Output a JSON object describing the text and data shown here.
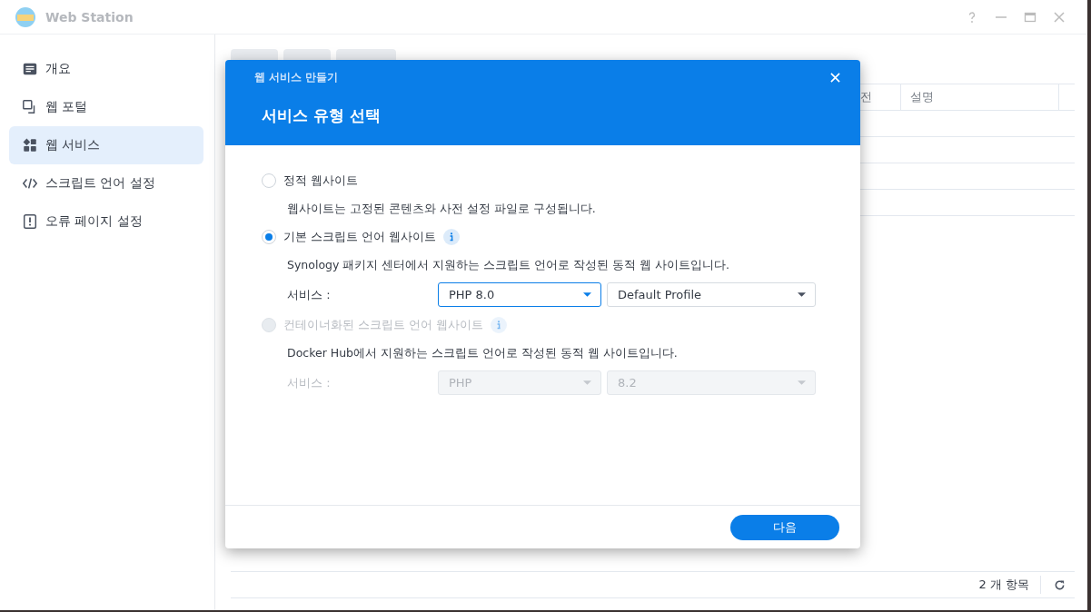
{
  "window": {
    "title": "Web Station"
  },
  "sidebar": {
    "items": [
      {
        "label": "개요",
        "selected": false
      },
      {
        "label": "웹 포털",
        "selected": false
      },
      {
        "label": "웹 서비스",
        "selected": true
      },
      {
        "label": "스크립트 언어 설정",
        "selected": false
      },
      {
        "label": "오류 페이지 설정",
        "selected": false
      }
    ]
  },
  "table": {
    "columns": [
      "전",
      "설명"
    ]
  },
  "status_bar": {
    "count": "2 개 항목"
  },
  "dialog": {
    "title": "웹 서비스 만들기",
    "heading": "서비스 유형 선택",
    "options": [
      {
        "label": "정적 웹사이트",
        "selected": false,
        "disabled": false,
        "info": false,
        "description": "웹사이트는 고정된 콘텐츠와 사전 설정 파일로 구성됩니다."
      },
      {
        "label": "기본 스크립트 언어 웹사이트",
        "selected": true,
        "disabled": false,
        "info": true,
        "description": "Synology 패키지 센터에서 지원하는 스크립트 언어로 작성된 동적 웹 사이트입니다.",
        "service_label": "서비스 :",
        "selects": [
          {
            "value": "PHP 8.0",
            "focused": true
          },
          {
            "value": "Default Profile",
            "focused": false
          }
        ]
      },
      {
        "label": "컨테이너화된 스크립트 언어 웹사이트",
        "selected": false,
        "disabled": true,
        "info": true,
        "description": "Docker Hub에서 지원하는 스크립트 언어로 작성된 동적 웹 사이트입니다.",
        "service_label": "서비스 :",
        "selects": [
          {
            "value": "PHP",
            "focused": false
          },
          {
            "value": "8.2",
            "focused": false
          }
        ]
      }
    ],
    "next_button": "다음"
  }
}
